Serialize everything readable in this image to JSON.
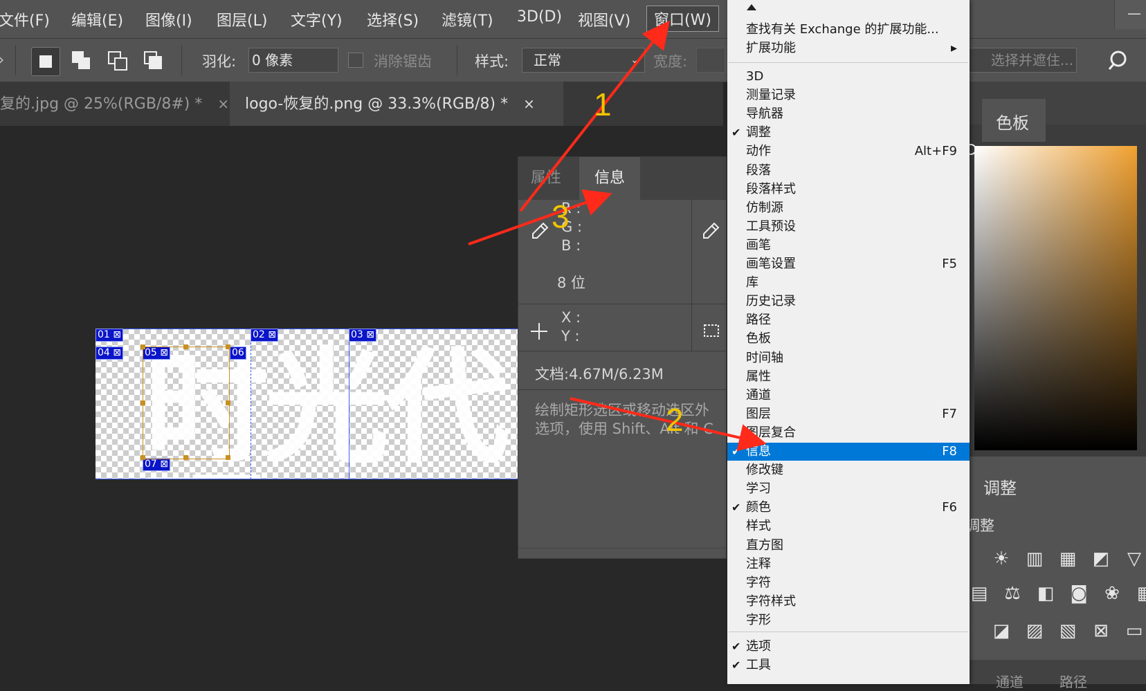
{
  "menubar": {
    "items": [
      "文件(F)",
      "编辑(E)",
      "图像(I)",
      "图层(L)",
      "文字(Y)",
      "选择(S)",
      "滤镜(T)",
      "3D(D)",
      "视图(V)",
      "窗口(W)"
    ],
    "minimize": "—"
  },
  "options": {
    "feather_label": "羽化:",
    "feather_value": "0 像素",
    "antialias_label": "消除锯齿",
    "style_label": "样式:",
    "style_value": "正常",
    "width_label": "宽度:",
    "select_mask": "选择并遮住..."
  },
  "tabs": [
    {
      "label": "复的.jpg @ 25%(RGB/8#) *",
      "close": "×"
    },
    {
      "label": "logo-恢复的.png @ 33.3%(RGB/8) *",
      "close": "×"
    }
  ],
  "canvas": {
    "slices": [
      "01",
      "02",
      "03",
      "04",
      "05",
      "06",
      "07"
    ],
    "ghost_text": "时光代理"
  },
  "info_panel": {
    "tabs": [
      "属性",
      "信息"
    ],
    "rgb": [
      "R :",
      "G :",
      "B :"
    ],
    "bits": "8 位",
    "xy": [
      "X :",
      "Y :"
    ],
    "doc": "文档:4.67M/6.23M",
    "hint1": "绘制矩形选区或移动选区外",
    "hint2": "选项，使用 Shift、Alt 和 C"
  },
  "window_menu": {
    "top_items": [
      {
        "name": "查找有关 Exchange 的扩展功能...",
        "sc": ""
      },
      {
        "name": "扩展功能",
        "sc": "▸"
      }
    ],
    "items": [
      {
        "name": "3D",
        "sc": "",
        "check": ""
      },
      {
        "name": "测量记录",
        "sc": "",
        "check": ""
      },
      {
        "name": "导航器",
        "sc": "",
        "check": ""
      },
      {
        "name": "调整",
        "sc": "",
        "check": "✔"
      },
      {
        "name": "动作",
        "sc": "Alt+F9",
        "check": ""
      },
      {
        "name": "段落",
        "sc": "",
        "check": ""
      },
      {
        "name": "段落样式",
        "sc": "",
        "check": ""
      },
      {
        "name": "仿制源",
        "sc": "",
        "check": ""
      },
      {
        "name": "工具预设",
        "sc": "",
        "check": ""
      },
      {
        "name": "画笔",
        "sc": "",
        "check": ""
      },
      {
        "name": "画笔设置",
        "sc": "F5",
        "check": ""
      },
      {
        "name": "库",
        "sc": "",
        "check": ""
      },
      {
        "name": "历史记录",
        "sc": "",
        "check": ""
      },
      {
        "name": "路径",
        "sc": "",
        "check": ""
      },
      {
        "name": "色板",
        "sc": "",
        "check": ""
      },
      {
        "name": "时间轴",
        "sc": "",
        "check": ""
      },
      {
        "name": "属性",
        "sc": "",
        "check": ""
      },
      {
        "name": "通道",
        "sc": "",
        "check": ""
      },
      {
        "name": "图层",
        "sc": "F7",
        "check": ""
      },
      {
        "name": "图层复合",
        "sc": "",
        "check": ""
      },
      {
        "name": "信息",
        "sc": "F8",
        "check": "✔"
      },
      {
        "name": "修改键",
        "sc": "",
        "check": ""
      },
      {
        "name": "学习",
        "sc": "",
        "check": ""
      },
      {
        "name": "颜色",
        "sc": "F6",
        "check": "✔"
      },
      {
        "name": "样式",
        "sc": "",
        "check": ""
      },
      {
        "name": "直方图",
        "sc": "",
        "check": ""
      },
      {
        "name": "注释",
        "sc": "",
        "check": ""
      },
      {
        "name": "字符",
        "sc": "",
        "check": ""
      },
      {
        "name": "字符样式",
        "sc": "",
        "check": ""
      },
      {
        "name": "字形",
        "sc": "",
        "check": ""
      }
    ],
    "bottom_items": [
      {
        "name": "选项",
        "sc": "",
        "check": "✔"
      },
      {
        "name": "工具",
        "sc": "",
        "check": "✔"
      }
    ]
  },
  "right_dock": {
    "swatch_tab": "色板",
    "adjust_tab": "调整",
    "adjust_label": "调整",
    "bottom_tabs": [
      "通道",
      "路径"
    ]
  },
  "annotations": {
    "n1": "1",
    "n2": "2",
    "n3": "3"
  },
  "colors": {
    "menu_highlight": "#0078d7",
    "arrow": "#ff2a1a",
    "annotation_number": "#f2c400",
    "slice_badge": "#0a14c8"
  }
}
